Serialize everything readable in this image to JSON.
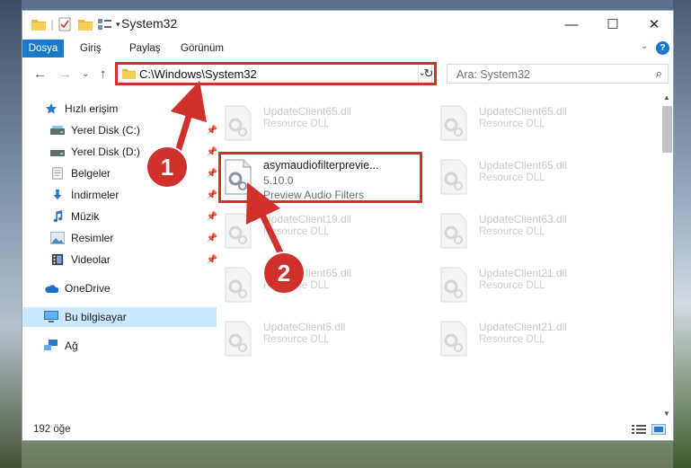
{
  "window": {
    "title": "System32"
  },
  "ribbon": {
    "tabs": [
      "Dosya",
      "Giriş",
      "Paylaş",
      "Görünüm"
    ]
  },
  "address": {
    "path": "C:\\Windows\\System32"
  },
  "search": {
    "placeholder": "Ara: System32"
  },
  "sidebar": {
    "items": [
      {
        "label": "Hızlı erişim",
        "icon": "star-icon"
      },
      {
        "label": "Yerel Disk (C:)",
        "icon": "drive-icon",
        "pinned": true
      },
      {
        "label": "Yerel Disk (D:)",
        "icon": "drive-icon",
        "pinned": true
      },
      {
        "label": "Belgeler",
        "icon": "documents-icon",
        "pinned": true
      },
      {
        "label": "İndirmeler",
        "icon": "downloads-icon",
        "pinned": true
      },
      {
        "label": "Müzik",
        "icon": "music-icon",
        "pinned": true
      },
      {
        "label": "Resimler",
        "icon": "pictures-icon",
        "pinned": true
      },
      {
        "label": "Videolar",
        "icon": "videos-icon",
        "pinned": true
      },
      {
        "label": "OneDrive",
        "icon": "cloud-icon"
      },
      {
        "label": "Bu bilgisayar",
        "icon": "computer-icon",
        "selected": true
      },
      {
        "label": "Ağ",
        "icon": "network-icon"
      }
    ]
  },
  "files": [
    {
      "name": "UpdateClient65.dll",
      "desc": "Resource DLL"
    },
    {
      "name": "UpdateClient65.dll",
      "desc": "Resource DLL"
    },
    {
      "name": "asymaudiofilterprevie...",
      "version": "5.10.0",
      "desc": "Preview Audio Filters"
    },
    {
      "name": "UpdateClient65.dll",
      "desc": "Resource DLL"
    },
    {
      "name": "UpdateClient19.dll",
      "desc": "Resource DLL"
    },
    {
      "name": "UpdateClient63.dll",
      "desc": "Resource DLL"
    },
    {
      "name": "UpdateClient65.dll",
      "desc": "Resource DLL"
    },
    {
      "name": "UpdateClient21.dll",
      "desc": "Resource DLL"
    },
    {
      "name": "UpdateClient5.dll",
      "desc": "Resource DLL"
    },
    {
      "name": "UpdateClient21.dll",
      "desc": "Resource DLL"
    }
  ],
  "status": {
    "count": "192 öğe"
  },
  "callouts": [
    "1",
    "2"
  ],
  "colors": {
    "accent": "#1979ca",
    "highlight": "#d0312d",
    "selected_bg": "#cce8ff"
  }
}
